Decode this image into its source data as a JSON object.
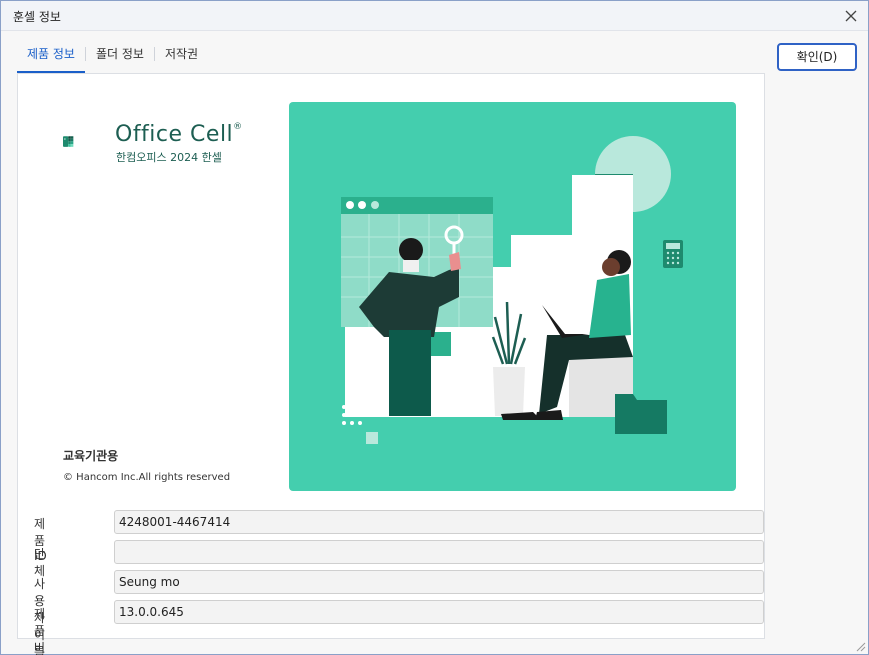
{
  "window": {
    "title": "훈셀 정보"
  },
  "tabs": [
    {
      "label": "제품 정보"
    },
    {
      "label": "폴더 정보"
    },
    {
      "label": "저작권"
    }
  ],
  "ok_button": {
    "label": "확인(D)"
  },
  "logo": {
    "name": "Office Cell",
    "registered": "®",
    "subtitle": "한컴오피스 2024 한셀"
  },
  "edition": "교육기관용",
  "copyright": "© Hancom Inc.All rights reserved",
  "fields": [
    {
      "label": "제품 ID",
      "value": "4248001-4467414"
    },
    {
      "label": "단체",
      "value": ""
    },
    {
      "label": "사용자 이름",
      "value": "Seung mo"
    },
    {
      "label": "제품 버전",
      "value": "13.0.0.645"
    }
  ],
  "colors": {
    "hero_bg": "#44ceae",
    "brand_dark": "#1d5e52",
    "accent": "#1a5fc9"
  }
}
